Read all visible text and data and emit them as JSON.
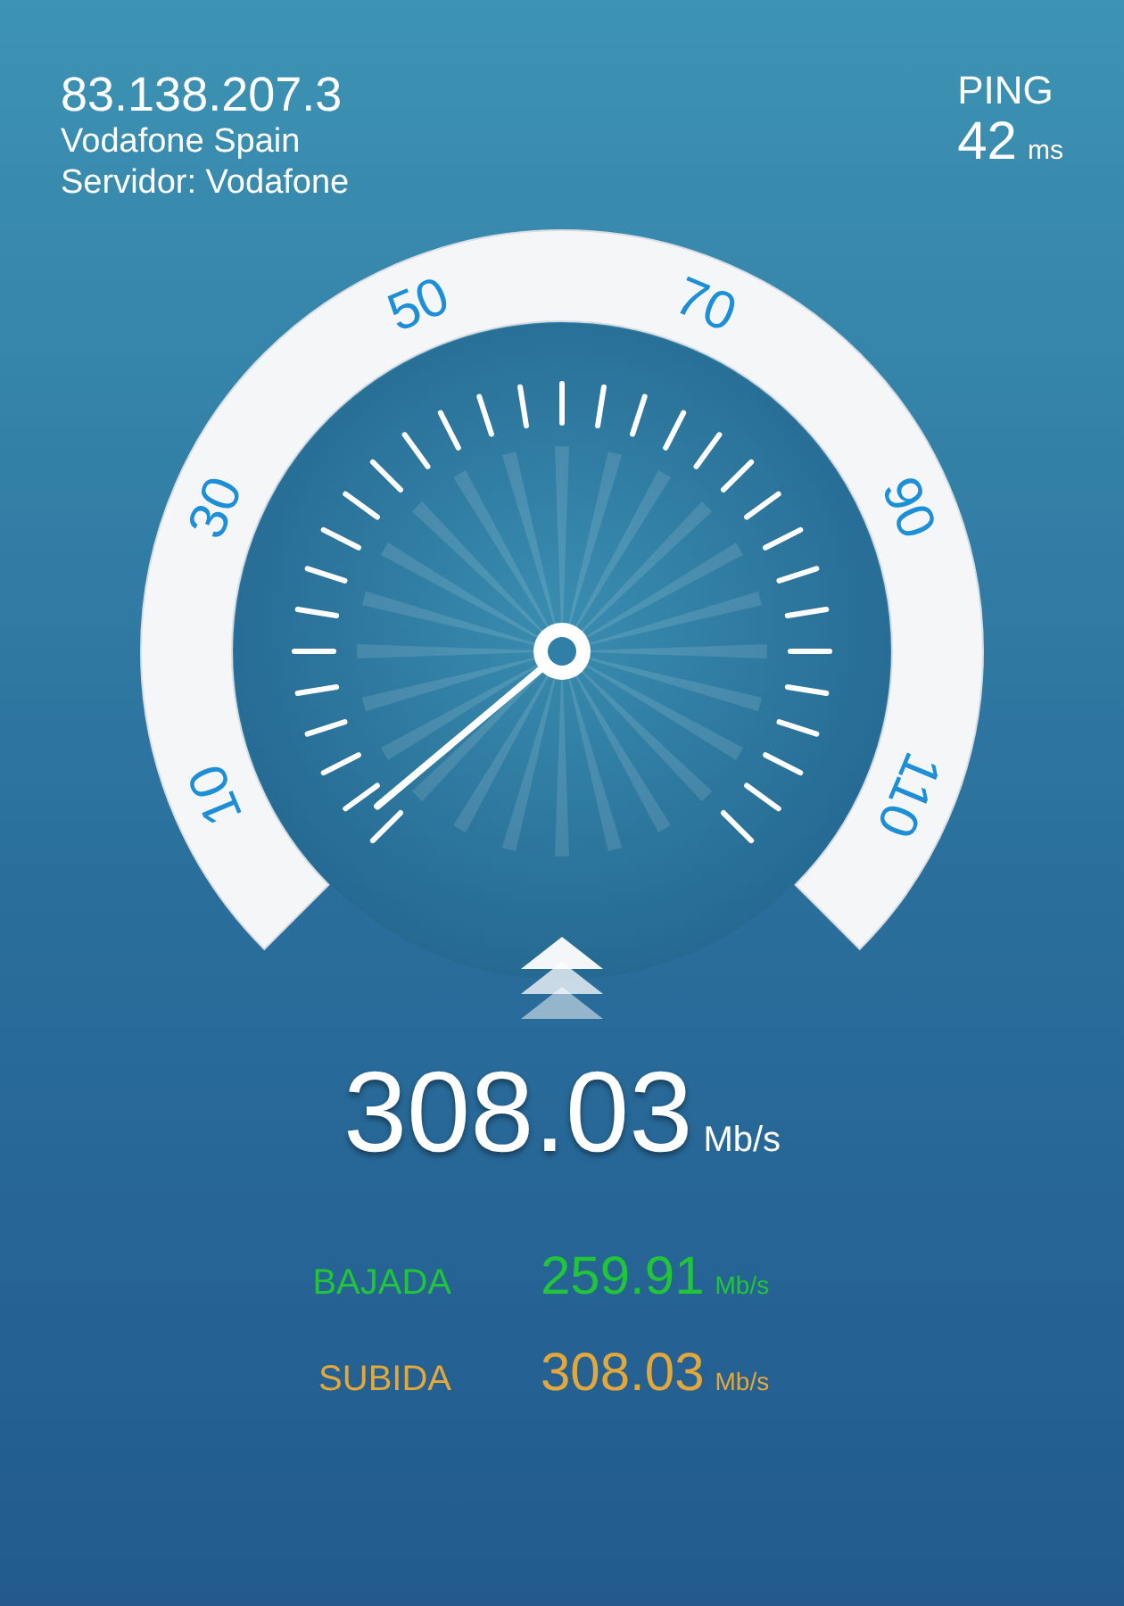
{
  "header": {
    "ip": "83.138.207.3",
    "isp": "Vodafone Spain",
    "server": "Servidor: Vodafone"
  },
  "ping": {
    "label": "PING",
    "value": "42",
    "unit": "ms"
  },
  "gauge": {
    "scale_labels": [
      "10",
      "30",
      "50",
      "70",
      "90",
      "110"
    ]
  },
  "speed": {
    "value": "308.03",
    "unit": "Mb/s"
  },
  "results": [
    {
      "label": "BAJADA",
      "value": "259.91",
      "unit": "Mb/s",
      "color": "#22c43a"
    },
    {
      "label": "SUBIDA",
      "value": "308.03",
      "unit": "Mb/s",
      "color": "#e3a83c"
    }
  ]
}
